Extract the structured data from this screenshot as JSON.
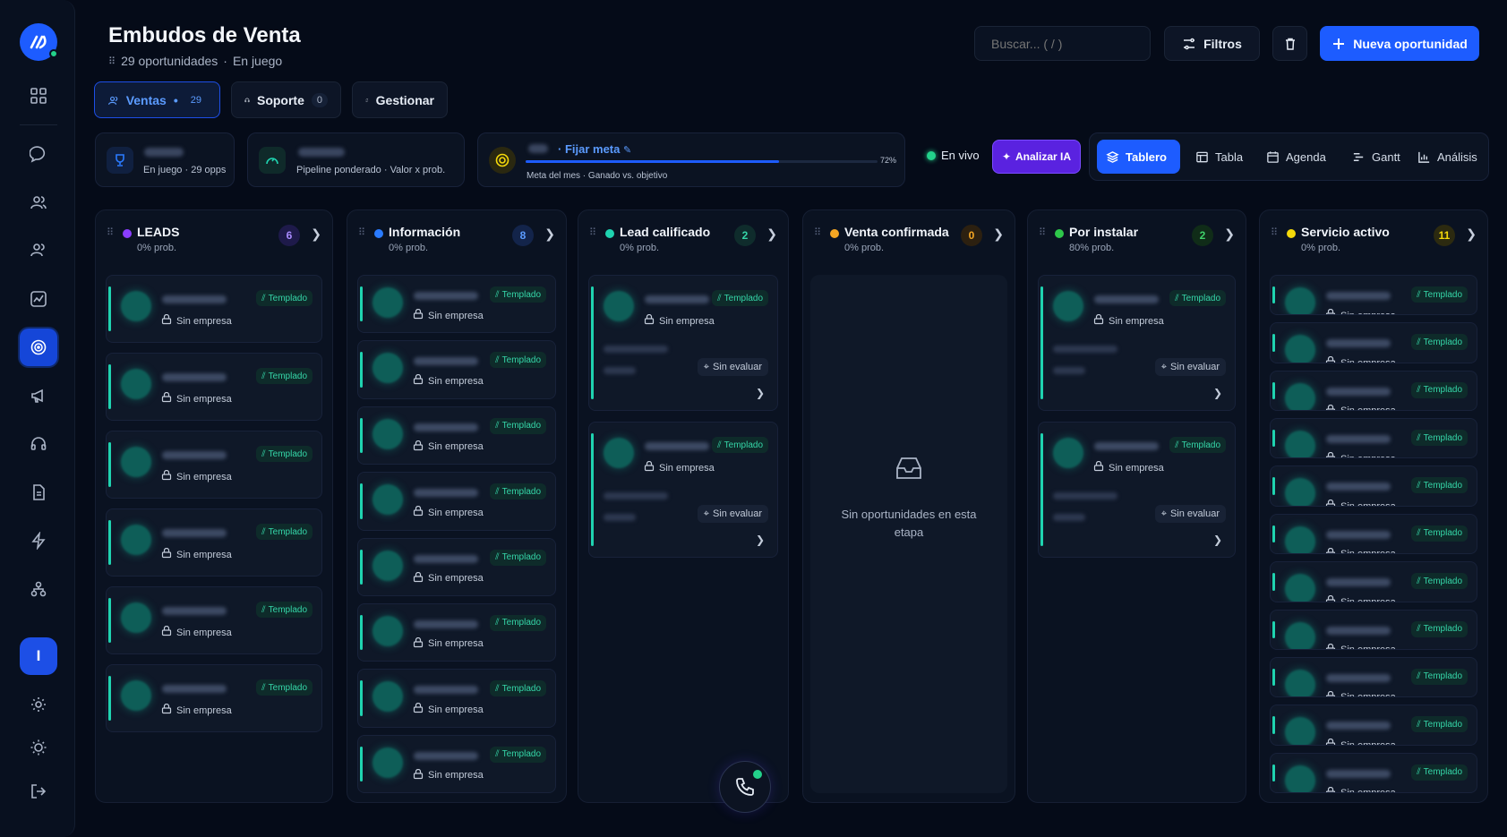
{
  "header": {
    "title": "Embudos de Venta",
    "count_text": "29 oportunidades",
    "separator": "·",
    "status_text": "En juego",
    "search_placeholder": "Buscar... ( / )",
    "filters_label": "Filtros",
    "new_label": "Nueva oportunidad"
  },
  "pipelines": [
    {
      "label": "Ventas",
      "count": "29"
    },
    {
      "label": "Soporte",
      "count": "0"
    },
    {
      "label": "Gestionar",
      "count": ""
    }
  ],
  "stats": {
    "in_play": "En juego · 29 opps",
    "weighted": "Pipeline ponderado · Valor x prob.",
    "goal_link": "· Fijar meta",
    "goal_sub": "Meta del mes · Ganado vs. objetivo",
    "goal_percent": "72%",
    "goal_progress": 0.72
  },
  "live_label": "En vivo",
  "ai_label": "Analizar IA",
  "views": [
    "Tablero",
    "Tabla",
    "Agenda",
    "Gantt",
    "Análisis"
  ],
  "colors": {
    "accent": "#1d5cff",
    "tag_text": "#35d6a8",
    "live": "#23d18b"
  },
  "columns": [
    {
      "name": "LEADS",
      "prob": "0% prob.",
      "count": "6",
      "dot": "#8b3dff",
      "count_bg": "#1e1a4a",
      "count_fg": "#a98bff"
    },
    {
      "name": "Información",
      "prob": "0% prob.",
      "count": "8",
      "dot": "#2a7bff",
      "count_bg": "#13244a",
      "count_fg": "#5b9bff"
    },
    {
      "name": "Lead calificado",
      "prob": "0% prob.",
      "count": "2",
      "dot": "#1fd3b0",
      "count_bg": "#0f2c2c",
      "count_fg": "#35d6a8"
    },
    {
      "name": "Venta confirmada",
      "prob": "0% prob.",
      "count": "0",
      "dot": "#f5a623",
      "count_bg": "#2c2010",
      "count_fg": "#f5a623"
    },
    {
      "name": "Por instalar",
      "prob": "80% prob.",
      "count": "2",
      "dot": "#2ec74a",
      "count_bg": "#102c18",
      "count_fg": "#3fd16a"
    },
    {
      "name": "Servicio activo",
      "prob": "0% prob.",
      "count": "11",
      "dot": "#f5d90a",
      "count_bg": "#2c2a10",
      "count_fg": "#f5d90a"
    }
  ],
  "card": {
    "tag": "Templado",
    "company": "Sin empresa",
    "eval": "Sin evaluar"
  },
  "empty_text": "Sin oportunidades en esta etapa"
}
